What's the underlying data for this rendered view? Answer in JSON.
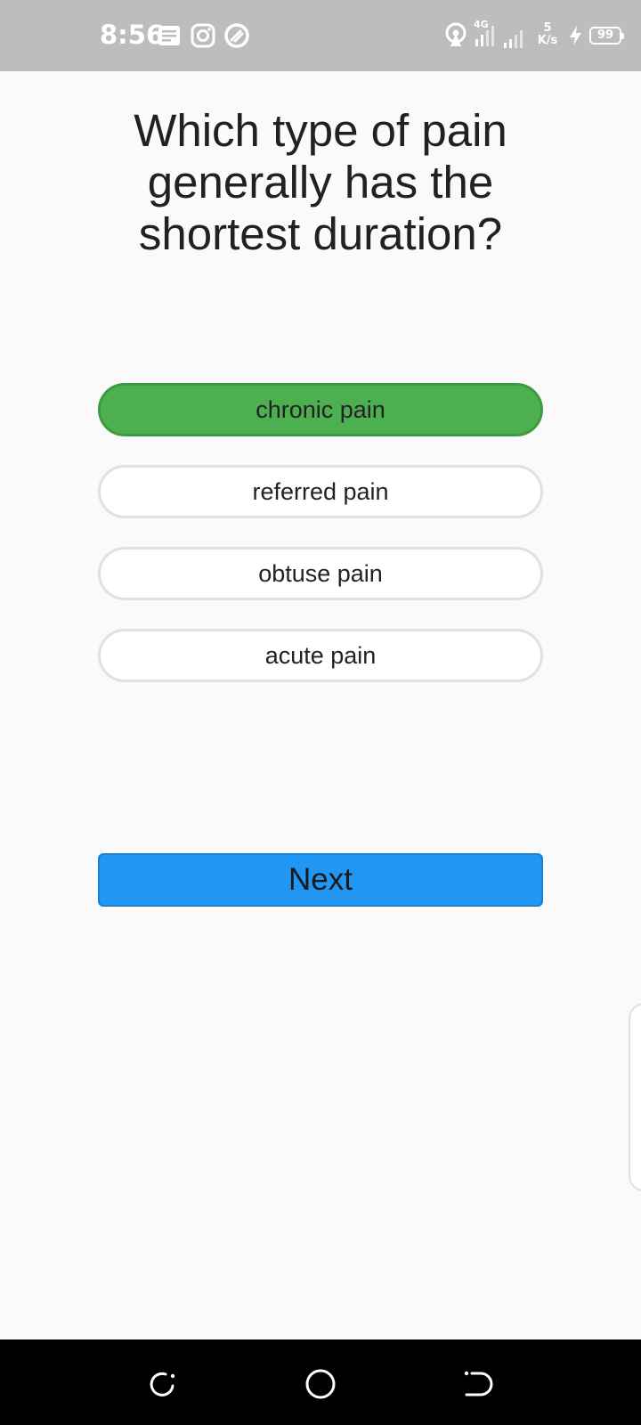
{
  "status_bar": {
    "time": "8:56",
    "left_icons": [
      "notes-icon",
      "instagram-icon",
      "app-icon"
    ],
    "right_icons": [
      "hotspot-icon",
      "signal-4g-icon",
      "signal-icon",
      "charging-icon"
    ],
    "network_type": "4G",
    "net_speed_value": "5",
    "net_speed_unit": "K/s",
    "battery": "99"
  },
  "question": {
    "text": "Which type of pain generally has the shortest duration?"
  },
  "options": [
    {
      "label": "chronic pain",
      "selected": true
    },
    {
      "label": "referred pain",
      "selected": false
    },
    {
      "label": "obtuse pain",
      "selected": false
    },
    {
      "label": "acute pain",
      "selected": false
    }
  ],
  "next_button": {
    "label": "Next"
  },
  "colors": {
    "selected_option": "#4caf50",
    "next_button": "#2196f3",
    "status_bar": "#bdbdbd",
    "background": "#fafafa"
  },
  "nav_bar": {
    "icons": [
      "recent-apps-icon",
      "home-icon",
      "back-icon"
    ]
  }
}
